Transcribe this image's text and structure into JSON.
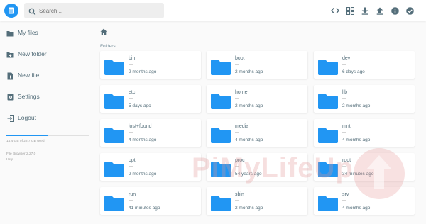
{
  "header": {
    "search_placeholder": "Search...",
    "logo_icon": "file-browser-logo-icon",
    "actions": [
      {
        "icon": "code-icon",
        "name": "switch-view"
      },
      {
        "icon": "grid-view-icon",
        "name": "view-mode"
      },
      {
        "icon": "download-icon",
        "name": "download"
      },
      {
        "icon": "upload-icon",
        "name": "upload"
      },
      {
        "icon": "info-icon",
        "name": "info"
      },
      {
        "icon": "check-circle-icon",
        "name": "select"
      }
    ]
  },
  "sidebar": {
    "items": [
      {
        "label": "My files",
        "icon": "folder-icon"
      },
      {
        "label": "New folder",
        "icon": "new-folder-icon"
      },
      {
        "label": "New file",
        "icon": "new-file-icon"
      },
      {
        "label": "Settings",
        "icon": "settings-icon"
      },
      {
        "label": "Logout",
        "icon": "logout-icon"
      }
    ],
    "storage": {
      "text": "14.4 GB of 28.7 GB used",
      "fraction": 0.5
    },
    "version": "File Browser 2.27.0",
    "help": "Help"
  },
  "main": {
    "section_title": "Folders",
    "folders": [
      {
        "name": "bin",
        "size": "—",
        "modified": "2 months ago"
      },
      {
        "name": "boot",
        "size": "—",
        "modified": "2 months ago"
      },
      {
        "name": "dev",
        "size": "—",
        "modified": "6 days ago"
      },
      {
        "name": "etc",
        "size": "—",
        "modified": "5 days ago"
      },
      {
        "name": "home",
        "size": "—",
        "modified": "2 months ago"
      },
      {
        "name": "lib",
        "size": "—",
        "modified": "2 months ago"
      },
      {
        "name": "lost+found",
        "size": "—",
        "modified": "4 months ago"
      },
      {
        "name": "media",
        "size": "—",
        "modified": "4 months ago"
      },
      {
        "name": "mnt",
        "size": "—",
        "modified": "4 months ago"
      },
      {
        "name": "opt",
        "size": "—",
        "modified": "2 months ago"
      },
      {
        "name": "proc",
        "size": "—",
        "modified": "54 years ago"
      },
      {
        "name": "root",
        "size": "—",
        "modified": "34 minutes ago"
      },
      {
        "name": "run",
        "size": "—",
        "modified": "41 minutes ago"
      },
      {
        "name": "sbin",
        "size": "—",
        "modified": "2 months ago"
      },
      {
        "name": "srv",
        "size": "—",
        "modified": "4 months ago"
      }
    ]
  },
  "watermark": {
    "text": "PiMyLifeUp"
  },
  "colors": {
    "accent": "#2196f3",
    "text": "#546e7a",
    "muted": "#9e9e9e",
    "background": "#fafafa"
  }
}
